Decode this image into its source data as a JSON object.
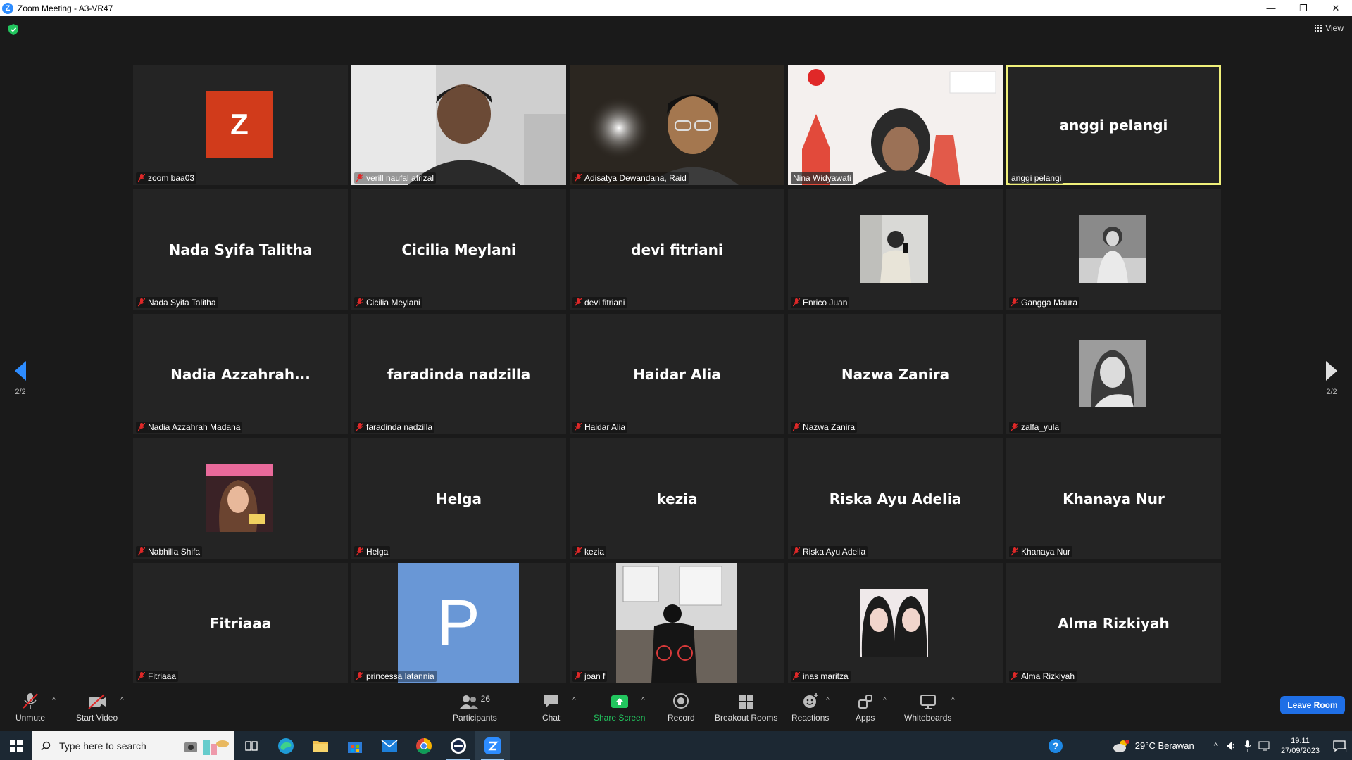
{
  "window": {
    "app_icon": "zoom-logo",
    "title": "Zoom Meeting - A3-VR47",
    "controls": [
      "minimize",
      "maximize",
      "close"
    ]
  },
  "meeting": {
    "view_label": "View",
    "page_left": "2/2",
    "page_right": "2/2",
    "tiles": [
      {
        "label": "zoom baa03",
        "kind": "avatar-letter",
        "letter": "Z",
        "color": "#d13b1b"
      },
      {
        "label": "verill naufal afrizal",
        "kind": "video"
      },
      {
        "label": "Adisatya Dewandana, Raid",
        "kind": "video"
      },
      {
        "label": "Nina Widyawati",
        "kind": "video",
        "muted": false
      },
      {
        "label": "anggi pelangi",
        "kind": "name",
        "name": "anggi pelangi",
        "active": true
      },
      {
        "label": "Nada Syifa Talitha",
        "kind": "name",
        "name": "Nada Syifa Talitha"
      },
      {
        "label": "Cicilia Meylani",
        "kind": "name",
        "name": "Cicilia Meylani"
      },
      {
        "label": "devi fitriani",
        "kind": "name",
        "name": "devi fitriani"
      },
      {
        "label": "Enrico Juan",
        "kind": "photo"
      },
      {
        "label": "Gangga Maura",
        "kind": "photo"
      },
      {
        "label": "Nadia Azzahrah Madana",
        "kind": "name",
        "name": "Nadia  Azzahrah..."
      },
      {
        "label": "faradinda nadzilla",
        "kind": "name",
        "name": "faradinda nadzilla"
      },
      {
        "label": "Haidar Alia",
        "kind": "name",
        "name": "Haidar Alia"
      },
      {
        "label": "Nazwa Zanira",
        "kind": "name",
        "name": "Nazwa Zanira"
      },
      {
        "label": "zalfa_yula",
        "kind": "photo"
      },
      {
        "label": "Nabhilla Shifa",
        "kind": "photo"
      },
      {
        "label": "Helga",
        "kind": "name",
        "name": "Helga"
      },
      {
        "label": "kezia",
        "kind": "name",
        "name": "kezia"
      },
      {
        "label": "Riska Ayu Adelia",
        "kind": "name",
        "name": "Riska Ayu Adelia"
      },
      {
        "label": "Khanaya Nur",
        "kind": "name",
        "name": "Khanaya Nur"
      },
      {
        "label": "Fitriaaa",
        "kind": "name",
        "name": "Fitriaaa"
      },
      {
        "label": "princessa latannia",
        "kind": "avatar-letter",
        "letter": "P",
        "color": "#6997d6"
      },
      {
        "label": "joan f",
        "kind": "video"
      },
      {
        "label": "inas maritza",
        "kind": "photo"
      },
      {
        "label": "Alma Rizkiyah",
        "kind": "name",
        "name": "Alma Rizkiyah"
      }
    ]
  },
  "toolbar": {
    "unmute": "Unmute",
    "start_video": "Start Video",
    "participants": "Participants",
    "participants_count": "26",
    "chat": "Chat",
    "share_screen": "Share Screen",
    "record": "Record",
    "breakout_rooms": "Breakout Rooms",
    "reactions": "Reactions",
    "apps": "Apps",
    "whiteboards": "Whiteboards",
    "leave_room": "Leave Room",
    "share_color": "#22c55e"
  },
  "taskbar": {
    "search_placeholder": "Type here to search",
    "apps": [
      "task-view",
      "edge",
      "file-explorer",
      "microsoft-store",
      "mail",
      "chrome",
      "app",
      "zoom"
    ],
    "weather": "29°C  Berawan",
    "time": "19.11",
    "date": "27/09/2023",
    "notification_count": "1"
  }
}
